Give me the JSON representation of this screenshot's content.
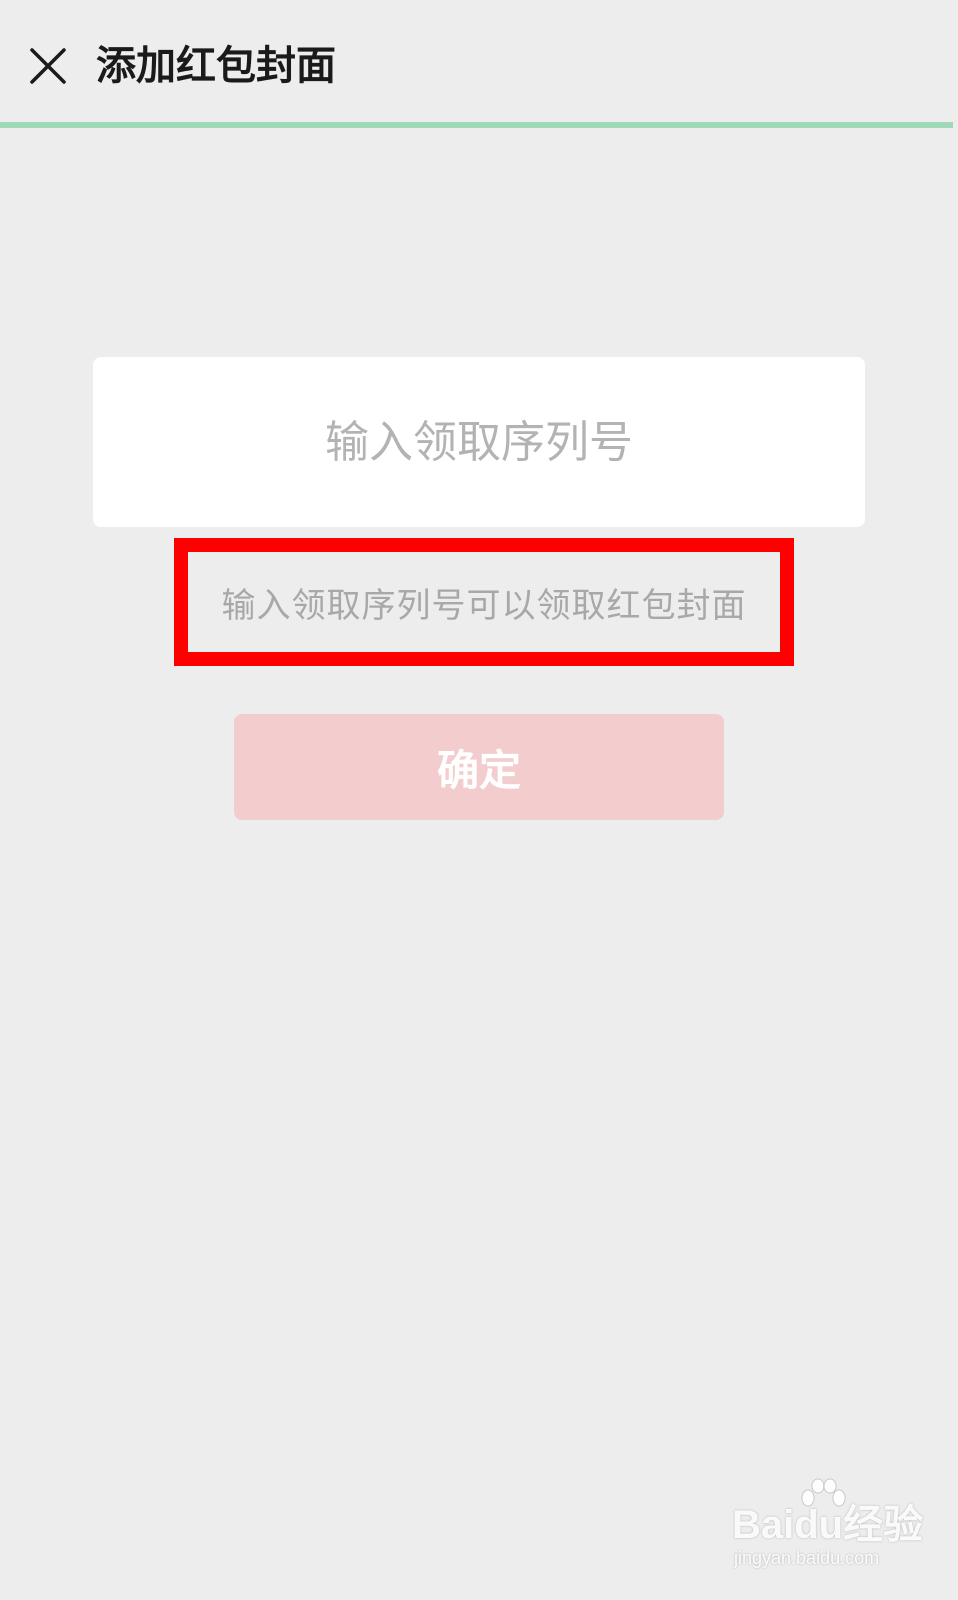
{
  "header": {
    "close_icon": "close-icon",
    "title": "添加红包封面"
  },
  "colors": {
    "background": "#ededed",
    "progress": "#9fd8b6",
    "highlight_border": "#ff0000",
    "confirm_button_bg": "#f3cdcd"
  },
  "form": {
    "serial_input": {
      "placeholder": "输入领取序列号",
      "value": ""
    },
    "hint": "输入领取序列号可以领取红包封面",
    "confirm_label": "确定"
  },
  "watermark": {
    "logo": "Baidu经验",
    "url": "jingyan.baidu.com"
  }
}
